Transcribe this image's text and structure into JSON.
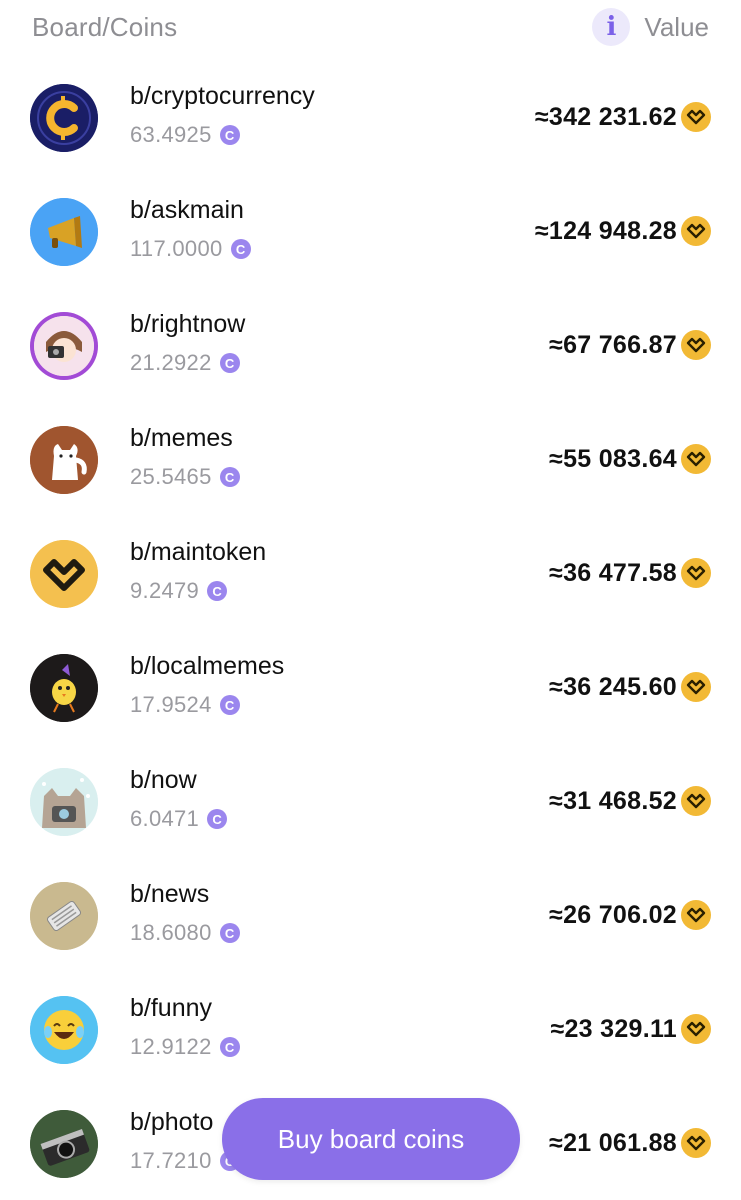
{
  "header": {
    "left_label": "Board/Coins",
    "info_icon_glyph": "i",
    "right_label": "Value"
  },
  "boards": [
    {
      "name": "b/cryptocurrency",
      "amount": "63.4925",
      "value": "≈342 231.62",
      "avatar_icon": "crypto-c-logo",
      "avatar_bg": "#1b1f6b"
    },
    {
      "name": "b/askmain",
      "amount": "117.0000",
      "value": "≈124 948.28",
      "avatar_icon": "megaphone",
      "avatar_bg": "#4aa3f5"
    },
    {
      "name": "b/rightnow",
      "amount": "21.2922",
      "value": "≈67 766.87",
      "avatar_icon": "girl-with-camera",
      "avatar_bg": "#f3d9e8"
    },
    {
      "name": "b/memes",
      "amount": "25.5465",
      "value": "≈55 083.64",
      "avatar_icon": "cat",
      "avatar_bg": "#a0552f"
    },
    {
      "name": "b/maintoken",
      "amount": "9.2479",
      "value": "≈36 477.58",
      "avatar_icon": "maintoken-logo",
      "avatar_bg": "#f4c04f"
    },
    {
      "name": "b/localmemes",
      "amount": "17.9524",
      "value": "≈36 245.60",
      "avatar_icon": "chick",
      "avatar_bg": "#1d1a1a"
    },
    {
      "name": "b/now",
      "amount": "6.0471",
      "value": "≈31 468.52",
      "avatar_icon": "cat-with-camera",
      "avatar_bg": "#d9efef"
    },
    {
      "name": "b/news",
      "amount": "18.6080",
      "value": "≈26 706.02",
      "avatar_icon": "newspaper",
      "avatar_bg": "#c9b98f"
    },
    {
      "name": "b/funny",
      "amount": "12.9122",
      "value": "≈23 329.11",
      "avatar_icon": "laughing-emoji",
      "avatar_bg": "#55c2f2"
    },
    {
      "name": "b/photo",
      "amount": "17.7210",
      "value": "≈21 061.88",
      "avatar_icon": "camera-photo",
      "avatar_bg": "#3f5b3a"
    }
  ],
  "coin_glyph": "C",
  "buy_button": {
    "label": "Buy board coins"
  },
  "colors": {
    "accent": "#8a6fe8",
    "coin_badge": "#9b86ee",
    "token_gold": "#f2b935",
    "muted_text": "#8e8e93"
  }
}
